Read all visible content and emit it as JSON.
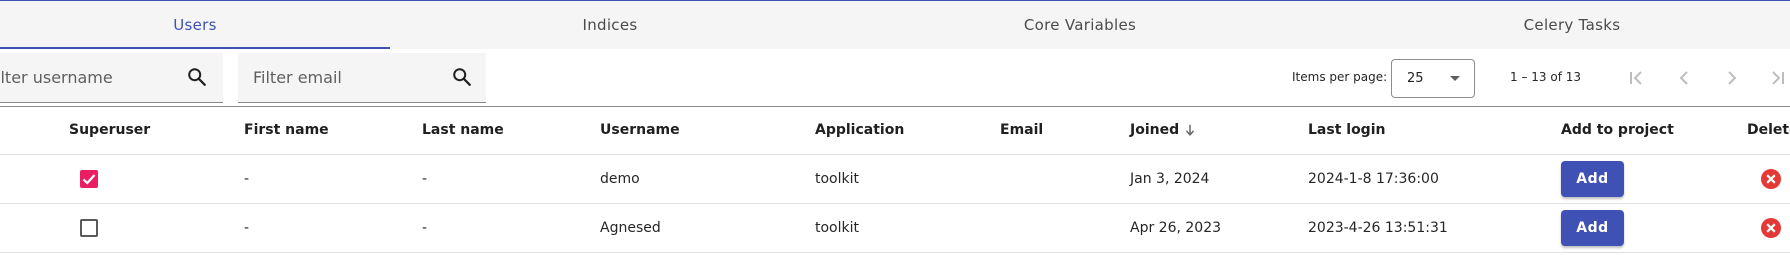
{
  "tabs": [
    {
      "label": "Users",
      "active": true
    },
    {
      "label": "Indices",
      "active": false
    },
    {
      "label": "Core Variables",
      "active": false
    },
    {
      "label": "Celery Tasks",
      "active": false
    }
  ],
  "filters": {
    "username_placeholder": "Filter username",
    "email_placeholder": "Filter email",
    "icon": "search-icon"
  },
  "paginator": {
    "items_per_page_label": "Items per page:",
    "page_size": "25",
    "range_label": "1 – 13 of 13",
    "buttons": [
      "first-page-icon",
      "previous-page-icon",
      "next-page-icon",
      "last-page-icon"
    ]
  },
  "table": {
    "columns": [
      "Superuser",
      "First name",
      "Last name",
      "Username",
      "Application",
      "Email",
      "Joined",
      "Last login",
      "Add to project",
      "Delete"
    ],
    "sort_column": "Joined",
    "sort_direction": "descending",
    "rows": [
      {
        "superuser": true,
        "first_name": "-",
        "last_name": "-",
        "username": "demo",
        "application": "toolkit",
        "email": "",
        "joined": "Jan 3, 2024",
        "last_login": "2024-1-8 17:36:00",
        "add_label": "Add"
      },
      {
        "superuser": false,
        "first_name": "-",
        "last_name": "-",
        "username": "Agnesed",
        "application": "toolkit",
        "email": "",
        "joined": "Apr 26, 2023",
        "last_login": "2023-4-26 13:51:31",
        "add_label": "Add"
      }
    ]
  },
  "colors": {
    "accent": "#3f51b5",
    "checkbox_checked": "#e91e63",
    "delete": "#e53935",
    "tab_bar": "#f5f5f5"
  }
}
